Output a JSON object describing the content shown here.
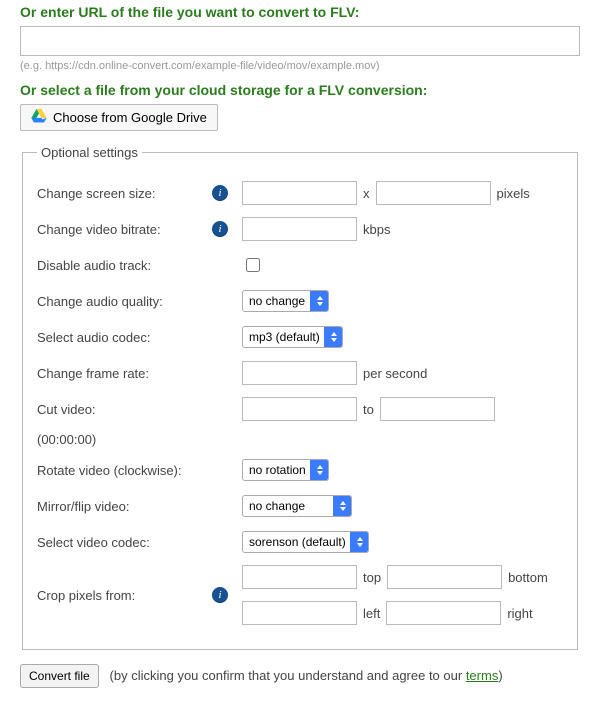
{
  "url_section": {
    "title": "Or enter URL of the file you want to convert to FLV:",
    "value": "",
    "hint": "(e.g. https://cdn.online-convert.com/example-file/video/mov/example.mov)"
  },
  "cloud_section": {
    "title": "Or select a file from your cloud storage for a FLV conversion:",
    "gdrive_label": "Choose from Google Drive"
  },
  "optional": {
    "legend": "Optional settings",
    "screen_size": {
      "label": "Change screen size:",
      "width": "",
      "height": "",
      "sep": "x",
      "unit": "pixels"
    },
    "bitrate": {
      "label": "Change video bitrate:",
      "value": "",
      "unit": "kbps"
    },
    "disable_audio": {
      "label": "Disable audio track:",
      "checked": false
    },
    "audio_quality": {
      "label": "Change audio quality:",
      "selected": "no change"
    },
    "audio_codec": {
      "label": "Select audio codec:",
      "selected": "mp3 (default)"
    },
    "frame_rate": {
      "label": "Change frame rate:",
      "value": "",
      "unit": "per second"
    },
    "cut_video": {
      "label": "Cut video:",
      "from": "",
      "to_label": "to",
      "to": "",
      "note": "(00:00:00)"
    },
    "rotate": {
      "label": "Rotate video (clockwise):",
      "selected": "no rotation"
    },
    "mirror": {
      "label": "Mirror/flip video:",
      "selected": "no change"
    },
    "video_codec": {
      "label": "Select video codec:",
      "selected": "sorenson (default)"
    },
    "crop": {
      "label": "Crop pixels from:",
      "top": "",
      "bottom": "",
      "left": "",
      "right": "",
      "top_label": "top",
      "bottom_label": "bottom",
      "left_label": "left",
      "right_label": "right"
    }
  },
  "footer": {
    "convert_label": "Convert file",
    "note_prefix": "(by clicking you confirm that you understand and agree to our ",
    "terms_label": "terms",
    "note_suffix": ")"
  }
}
